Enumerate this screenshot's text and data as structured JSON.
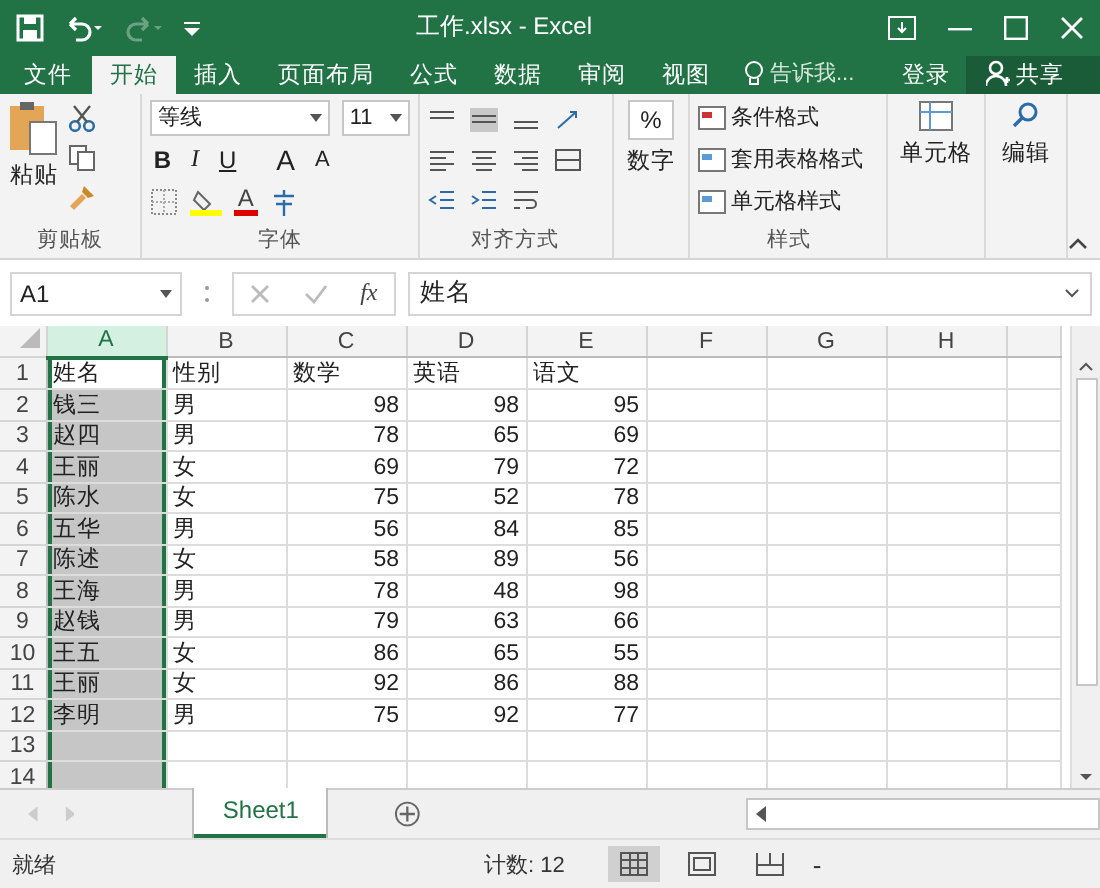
{
  "window": {
    "title": "工作.xlsx - Excel"
  },
  "quick_access": [
    {
      "kind": "save",
      "disabled": false
    },
    {
      "kind": "undo",
      "disabled": false
    },
    {
      "kind": "redo",
      "disabled": true
    }
  ],
  "tabs": [
    {
      "label": "文件",
      "selected": false
    },
    {
      "label": "开始",
      "selected": true
    },
    {
      "label": "插入",
      "selected": false
    },
    {
      "label": "页面布局",
      "selected": false
    },
    {
      "label": "公式",
      "selected": false
    },
    {
      "label": "数据",
      "selected": false
    },
    {
      "label": "审阅",
      "selected": false
    },
    {
      "label": "视图",
      "selected": false
    }
  ],
  "tell_me": {
    "placeholder": "告诉我..."
  },
  "sign_in": "登录",
  "share": "共享",
  "ribbon": {
    "clipboard": {
      "label": "剪贴板",
      "paste": "粘贴"
    },
    "font": {
      "label": "字体",
      "font_name": "等线",
      "font_size": "11",
      "bold": "B",
      "italic": "I",
      "underline": "U",
      "grow": "A",
      "shrink": "A",
      "font_color": "A"
    },
    "alignment": {
      "label": "对齐方式"
    },
    "number": {
      "label": "数字",
      "symbol": "%"
    },
    "styles": {
      "label": "样式",
      "items": [
        "条件格式",
        "套用表格格式",
        "单元格样式"
      ]
    },
    "cells": {
      "label": "单元格"
    },
    "editing": {
      "label": "编辑"
    }
  },
  "formula_bar": {
    "name_box": "A1",
    "fx": "fx",
    "value": "姓名"
  },
  "sheet": {
    "columns": [
      {
        "label": "A",
        "selected": true,
        "kind": "text"
      },
      {
        "label": "B",
        "selected": false,
        "kind": "text"
      },
      {
        "label": "C",
        "selected": false,
        "kind": "number"
      },
      {
        "label": "D",
        "selected": false,
        "kind": "number"
      },
      {
        "label": "E",
        "selected": false,
        "kind": "number"
      },
      {
        "label": "F",
        "selected": false,
        "kind": "text"
      },
      {
        "label": "G",
        "selected": false,
        "kind": "text"
      },
      {
        "label": "H",
        "selected": false,
        "kind": "text"
      }
    ],
    "rows": [
      {
        "number": "1",
        "kind": "header",
        "cells": [
          "姓名",
          "性别",
          "数学",
          "英语",
          "语文"
        ]
      },
      {
        "number": "2",
        "kind": "data",
        "cells": [
          "钱三",
          "男",
          "98",
          "98",
          "95"
        ]
      },
      {
        "number": "3",
        "kind": "data",
        "cells": [
          "赵四",
          "男",
          "78",
          "65",
          "69"
        ]
      },
      {
        "number": "4",
        "kind": "data",
        "cells": [
          "王丽",
          "女",
          "69",
          "79",
          "72"
        ]
      },
      {
        "number": "5",
        "kind": "data",
        "cells": [
          "陈水",
          "女",
          "75",
          "52",
          "78"
        ]
      },
      {
        "number": "6",
        "kind": "data",
        "cells": [
          "五华",
          "男",
          "56",
          "84",
          "85"
        ]
      },
      {
        "number": "7",
        "kind": "data",
        "cells": [
          "陈述",
          "女",
          "58",
          "89",
          "56"
        ]
      },
      {
        "number": "8",
        "kind": "data",
        "cells": [
          "王海",
          "男",
          "78",
          "48",
          "98"
        ]
      },
      {
        "number": "9",
        "kind": "data",
        "cells": [
          "赵钱",
          "男",
          "79",
          "63",
          "66"
        ]
      },
      {
        "number": "10",
        "kind": "data",
        "cells": [
          "王五",
          "女",
          "86",
          "65",
          "55"
        ]
      },
      {
        "number": "11",
        "kind": "data",
        "cells": [
          "王丽",
          "女",
          "92",
          "86",
          "88"
        ]
      },
      {
        "number": "12",
        "kind": "data",
        "cells": [
          "李明",
          "男",
          "75",
          "92",
          "77"
        ]
      },
      {
        "number": "13",
        "kind": "data"
      },
      {
        "number": "14",
        "kind": "data"
      }
    ]
  },
  "sheet_tabs": [
    {
      "label": "Sheet1",
      "selected": true
    }
  ],
  "status_bar": {
    "ready": "就绪",
    "count": "计数: 12",
    "zoom_out": "-",
    "views": [
      {
        "kind": "normal",
        "selected": true
      },
      {
        "kind": "page_layout",
        "selected": false
      },
      {
        "kind": "page_break",
        "selected": false
      }
    ]
  }
}
